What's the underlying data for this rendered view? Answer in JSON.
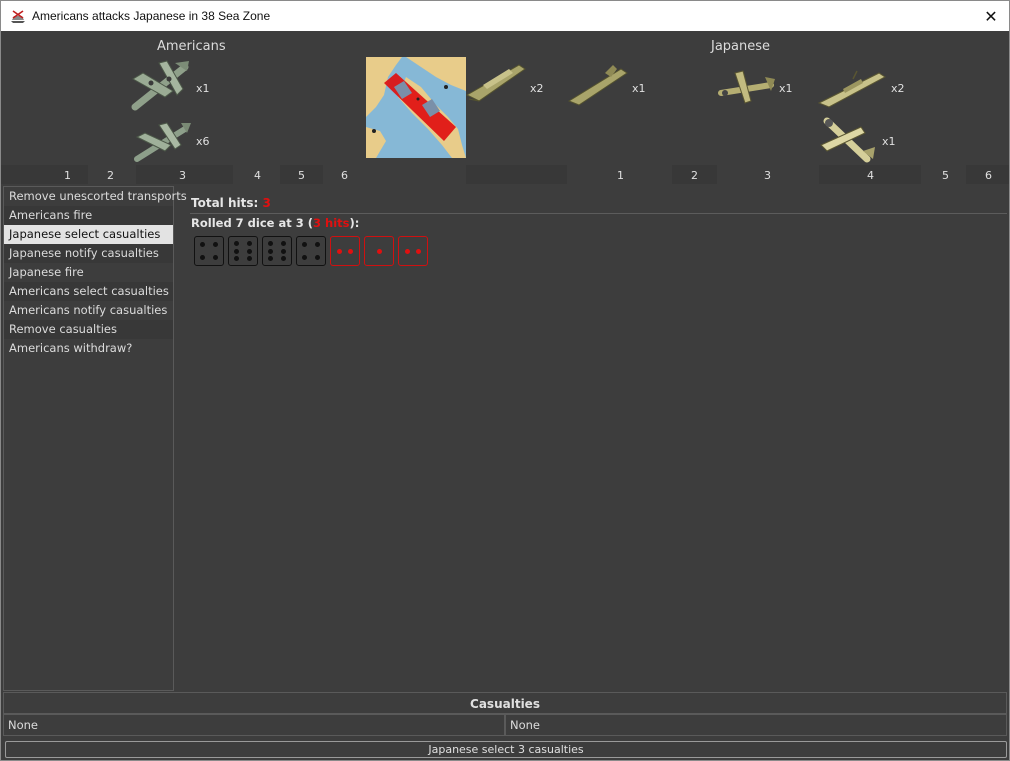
{
  "window": {
    "title": "Americans attacks Japanese in 38 Sea Zone",
    "close_glyph": "✕"
  },
  "attacker": {
    "name": "Americans",
    "units": [
      {
        "icon": "bomber-icon",
        "count": "x1"
      },
      {
        "icon": "fighter-icon",
        "count": "x6"
      }
    ]
  },
  "defender": {
    "name": "Japanese",
    "units": [
      {
        "icon": "transport-icon",
        "count": "x2"
      },
      {
        "icon": "submarine-icon",
        "count": "x1"
      },
      {
        "icon": "fighter-icon",
        "count": "x1"
      },
      {
        "icon": "destroyer-icon",
        "count": "x2"
      },
      {
        "icon": "carrier-plane-icon",
        "count": "x1"
      }
    ]
  },
  "ruler": {
    "attacker_labels": [
      "1",
      "2",
      "3",
      "4",
      "5",
      "6"
    ],
    "defender_labels": [
      "1",
      "2",
      "3",
      "4",
      "5",
      "6"
    ]
  },
  "steps": [
    "Remove unescorted transports",
    "Americans fire",
    "Japanese select casualties",
    "Japanese notify casualties",
    "Japanese fire",
    "Americans select casualties",
    "Americans notify casualties",
    "Remove casualties",
    "Americans withdraw?"
  ],
  "results": {
    "total_label": "Total hits:",
    "total_value": "3",
    "rolled_prefix": "Rolled 7 dice at 3 (",
    "rolled_hits": "3 hits",
    "rolled_suffix": "):",
    "dice": [
      {
        "value": 4,
        "hit": false
      },
      {
        "value": 6,
        "hit": false
      },
      {
        "value": 6,
        "hit": false
      },
      {
        "value": 4,
        "hit": false
      },
      {
        "value": 2,
        "hit": true
      },
      {
        "value": 1,
        "hit": true
      },
      {
        "value": 2,
        "hit": true
      }
    ]
  },
  "casualties": {
    "header": "Casualties",
    "left": "None",
    "right": "None"
  },
  "status_button": "Japanese select 3 casualties",
  "colors": {
    "hit_red": "#e01010",
    "selected_bg": "#e3e3e3",
    "panel_bg": "#3d3d3d"
  }
}
